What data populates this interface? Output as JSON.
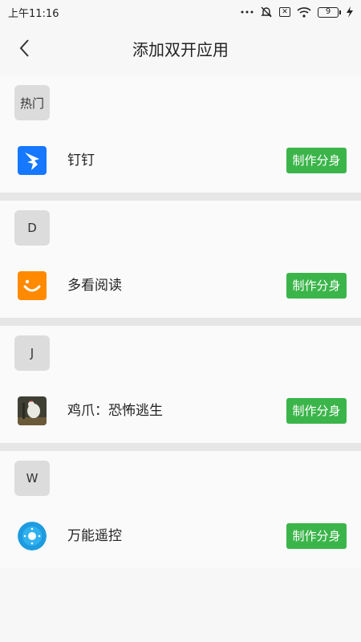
{
  "status_bar": {
    "time": "上午11:16",
    "sim_icon_label": "✕",
    "battery": "9"
  },
  "header": {
    "title": "添加双开应用"
  },
  "sections": [
    {
      "letter": "热门",
      "apps": [
        {
          "name": "钉钉",
          "button": "制作分身",
          "icon": "dingtalk-icon",
          "color": "#1677ff"
        }
      ]
    },
    {
      "letter": "D",
      "apps": [
        {
          "name": "多看阅读",
          "button": "制作分身",
          "icon": "duokan-icon",
          "color": "#ff8a00"
        }
      ]
    },
    {
      "letter": "J",
      "apps": [
        {
          "name": "鸡爪：恐怖逃生",
          "button": "制作分身",
          "icon": "chicken-game-icon",
          "color": "#4b4b3c"
        }
      ]
    },
    {
      "letter": "W",
      "apps": [
        {
          "name": "万能遥控",
          "button": "制作分身",
          "icon": "remote-control-icon",
          "color": "#1e9be0"
        }
      ]
    }
  ],
  "colors": {
    "accent_button": "#3bb54a",
    "section_badge": "#dcdcdc",
    "background": "#f7f7f7"
  }
}
